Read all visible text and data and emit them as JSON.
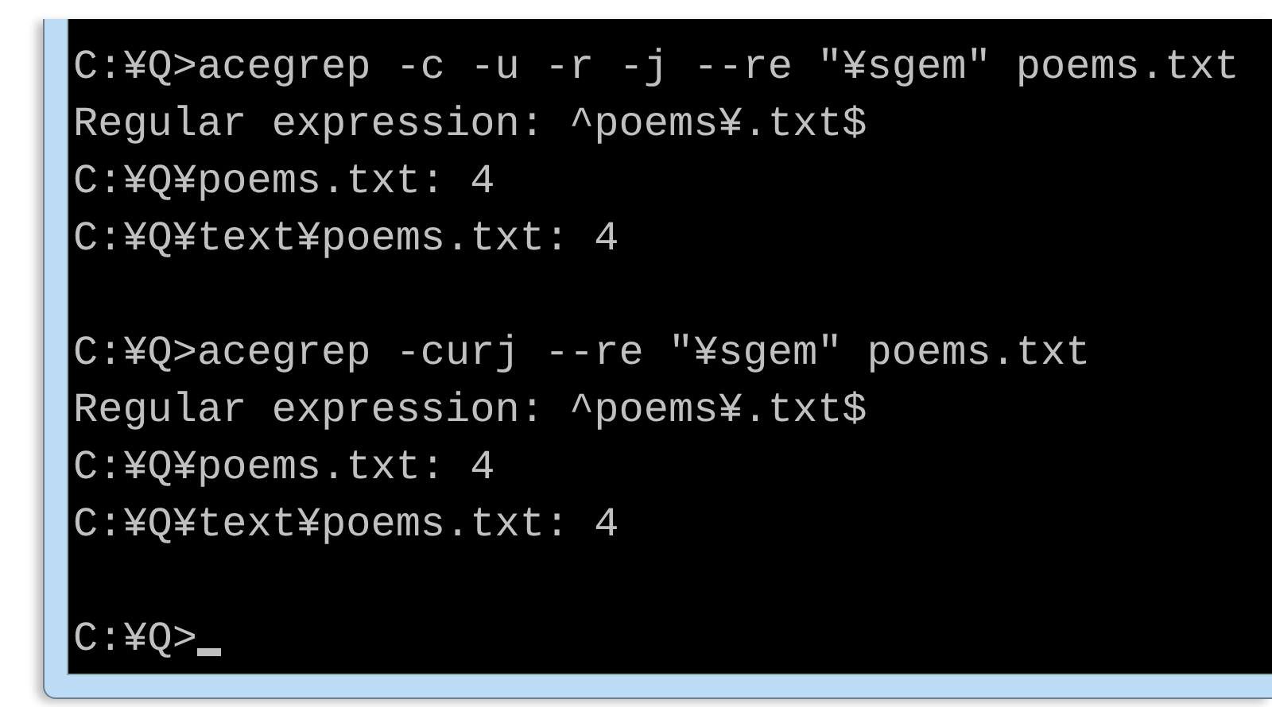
{
  "console": {
    "blocks": [
      {
        "lines": [
          "C:¥Q>acegrep -c -u -r -j --re \"¥sgem\" poems.txt",
          "Regular expression: ^poems¥.txt$",
          "C:¥Q¥poems.txt: 4",
          "C:¥Q¥text¥poems.txt: 4"
        ]
      },
      {
        "lines": [
          "C:¥Q>acegrep -curj --re \"¥sgem\" poems.txt",
          "Regular expression: ^poems¥.txt$",
          "C:¥Q¥poems.txt: 4",
          "C:¥Q¥text¥poems.txt: 4"
        ]
      }
    ],
    "prompt": {
      "text": "C:¥Q>",
      "cursor": true
    }
  }
}
